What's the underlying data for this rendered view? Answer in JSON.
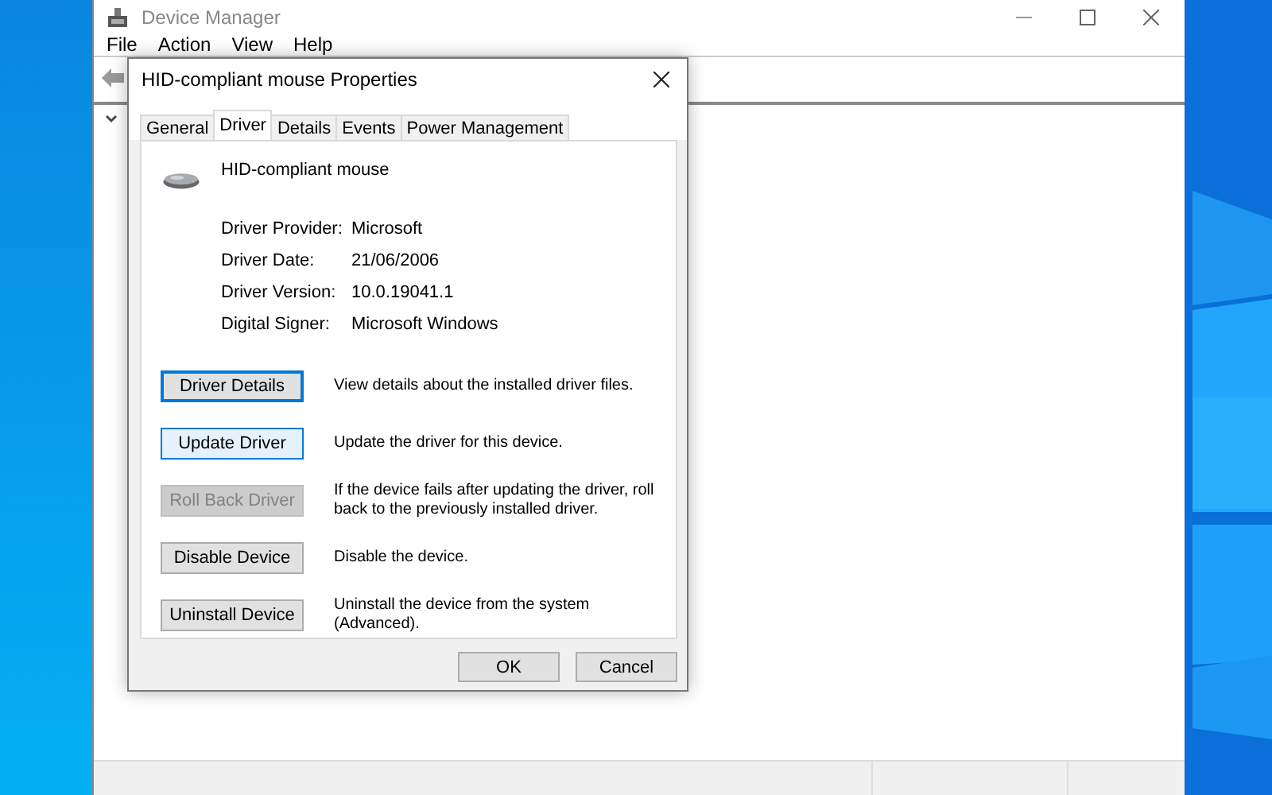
{
  "main_window": {
    "title": "Device Manager",
    "menu": [
      "File",
      "Action",
      "View",
      "Help"
    ]
  },
  "dialog": {
    "title": "HID-compliant mouse Properties",
    "tabs": [
      {
        "label": "General",
        "selected": false
      },
      {
        "label": "Driver",
        "selected": true
      },
      {
        "label": "Details",
        "selected": false
      },
      {
        "label": "Events",
        "selected": false
      },
      {
        "label": "Power Management",
        "selected": false
      }
    ],
    "device_name": "HID-compliant mouse",
    "properties": [
      {
        "label": "Driver Provider:",
        "value": "Microsoft"
      },
      {
        "label": "Driver Date:",
        "value": "21/06/2006"
      },
      {
        "label": "Driver Version:",
        "value": "10.0.19041.1"
      },
      {
        "label": "Digital Signer:",
        "value": "Microsoft Windows"
      }
    ],
    "actions": [
      {
        "label": "Driver Details",
        "description": "View details about the installed driver files.",
        "disabled": false,
        "focused": true,
        "hovered": false
      },
      {
        "label": "Update Driver",
        "description": "Update the driver for this device.",
        "disabled": false,
        "focused": false,
        "hovered": true
      },
      {
        "label": "Roll Back Driver",
        "description": "If the device fails after updating the driver, roll back to the previously installed driver.",
        "disabled": true,
        "focused": false,
        "hovered": false
      },
      {
        "label": "Disable Device",
        "description": "Disable the device.",
        "disabled": false,
        "focused": false,
        "hovered": false
      },
      {
        "label": "Uninstall Device",
        "description": "Uninstall the device from the system (Advanced).",
        "disabled": false,
        "focused": false,
        "hovered": false
      }
    ],
    "buttons": [
      "OK",
      "Cancel"
    ]
  }
}
